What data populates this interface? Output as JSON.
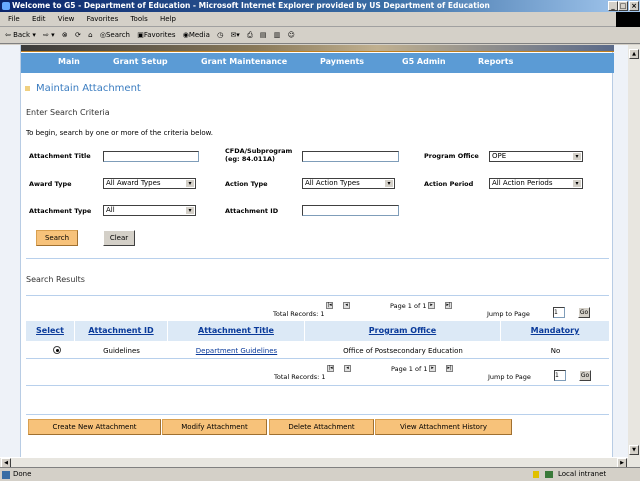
{
  "window": {
    "title": "Welcome to G5 - Department of Education - Microsoft Internet Explorer provided by US Department of Education"
  },
  "menu": [
    "File",
    "Edit",
    "View",
    "Favorites",
    "Tools",
    "Help"
  ],
  "toolbar": {
    "back": "Back",
    "search": "Search",
    "favorites": "Favorites",
    "media": "Media"
  },
  "nav": [
    "Main",
    "Grant Setup",
    "Grant Maintenance",
    "Payments",
    "G5 Admin",
    "Reports"
  ],
  "page": {
    "title": "Maintain Attachment",
    "subtitle": "Enter Search Criteria",
    "instructions": "To begin, search by one or more of the criteria below."
  },
  "form": {
    "attachment_title": {
      "label": "Attachment Title",
      "value": ""
    },
    "cfda": {
      "label": "CFDA/Subprogram",
      "label2": "(eg: 84.011A)",
      "value": ""
    },
    "program_office": {
      "label": "Program Office",
      "value": "OPE"
    },
    "award_type": {
      "label": "Award Type",
      "value": "All Award Types"
    },
    "action_type": {
      "label": "Action Type",
      "value": "All Action Types"
    },
    "action_period": {
      "label": "Action Period",
      "value": "All Action Periods"
    },
    "attachment_type": {
      "label": "Attachment Type",
      "value": "All"
    },
    "attachment_id": {
      "label": "Attachment ID",
      "value": ""
    },
    "search": "Search",
    "clear": "Clear"
  },
  "results": {
    "heading": "Search Results",
    "total": "Total Records: 1",
    "page": "Page 1 of 1",
    "jump": "Jump to Page",
    "jump_value": "1",
    "go": "Go",
    "columns": [
      "Select",
      "Attachment ID",
      "Attachment Title",
      "Program Office",
      "Mandatory"
    ],
    "rows": [
      {
        "selected": true,
        "id": "Guidelines",
        "title": "Department Guidelines",
        "office": "Office of Postsecondary Education",
        "mandatory": "No"
      }
    ]
  },
  "actions": [
    "Create New Attachment",
    "Modify Attachment",
    "Delete Attachment",
    "View Attachment History"
  ],
  "status": {
    "text": "Done",
    "zone": "Local intranet"
  }
}
